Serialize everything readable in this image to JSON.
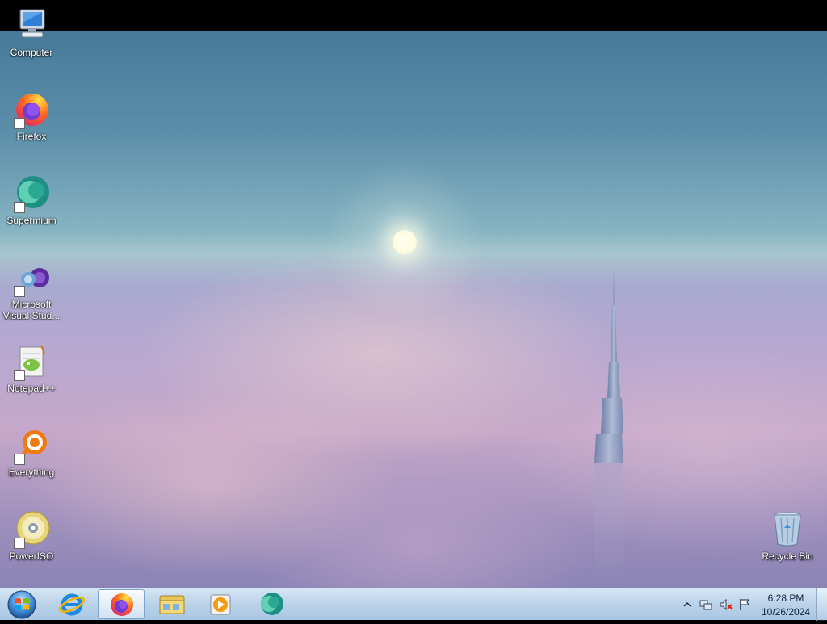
{
  "desktop": {
    "icons": [
      {
        "label": "Computer",
        "icon": "computer-icon",
        "shortcut": false
      },
      {
        "label": "Firefox",
        "icon": "firefox-icon",
        "shortcut": true
      },
      {
        "label": "Supermium",
        "icon": "supermium-icon",
        "shortcut": true
      },
      {
        "label": "Microsoft Visual Stud...",
        "icon": "visual-studio-icon",
        "shortcut": true
      },
      {
        "label": "Notepad++",
        "icon": "notepadplusplus-icon",
        "shortcut": true
      },
      {
        "label": "Everything",
        "icon": "everything-icon",
        "shortcut": true
      },
      {
        "label": "PowerISO",
        "icon": "poweriso-icon",
        "shortcut": true
      },
      {
        "label": "Recycle Bin",
        "icon": "recycle-bin-icon",
        "shortcut": false
      }
    ]
  },
  "taskbar": {
    "start": {
      "icon": "windows-start-icon"
    },
    "pinned": [
      {
        "icon": "internet-explorer-icon",
        "active": false
      },
      {
        "icon": "firefox-icon",
        "active": true
      },
      {
        "icon": "file-explorer-icon",
        "active": false
      },
      {
        "icon": "media-player-icon",
        "active": false
      },
      {
        "icon": "supermium-icon",
        "active": false
      }
    ],
    "tray": {
      "icons": [
        "show-hidden-icons-chevron",
        "network-icon",
        "volume-muted-icon",
        "action-center-flag-icon"
      ],
      "time": "6:28 PM",
      "date": "10/26/2024"
    }
  },
  "colors": {
    "taskbar_top": "#d6e6f4",
    "taskbar_bottom": "#a9c6e3",
    "sky_top": "#477a9a",
    "clouds": "#c6a7c9"
  }
}
